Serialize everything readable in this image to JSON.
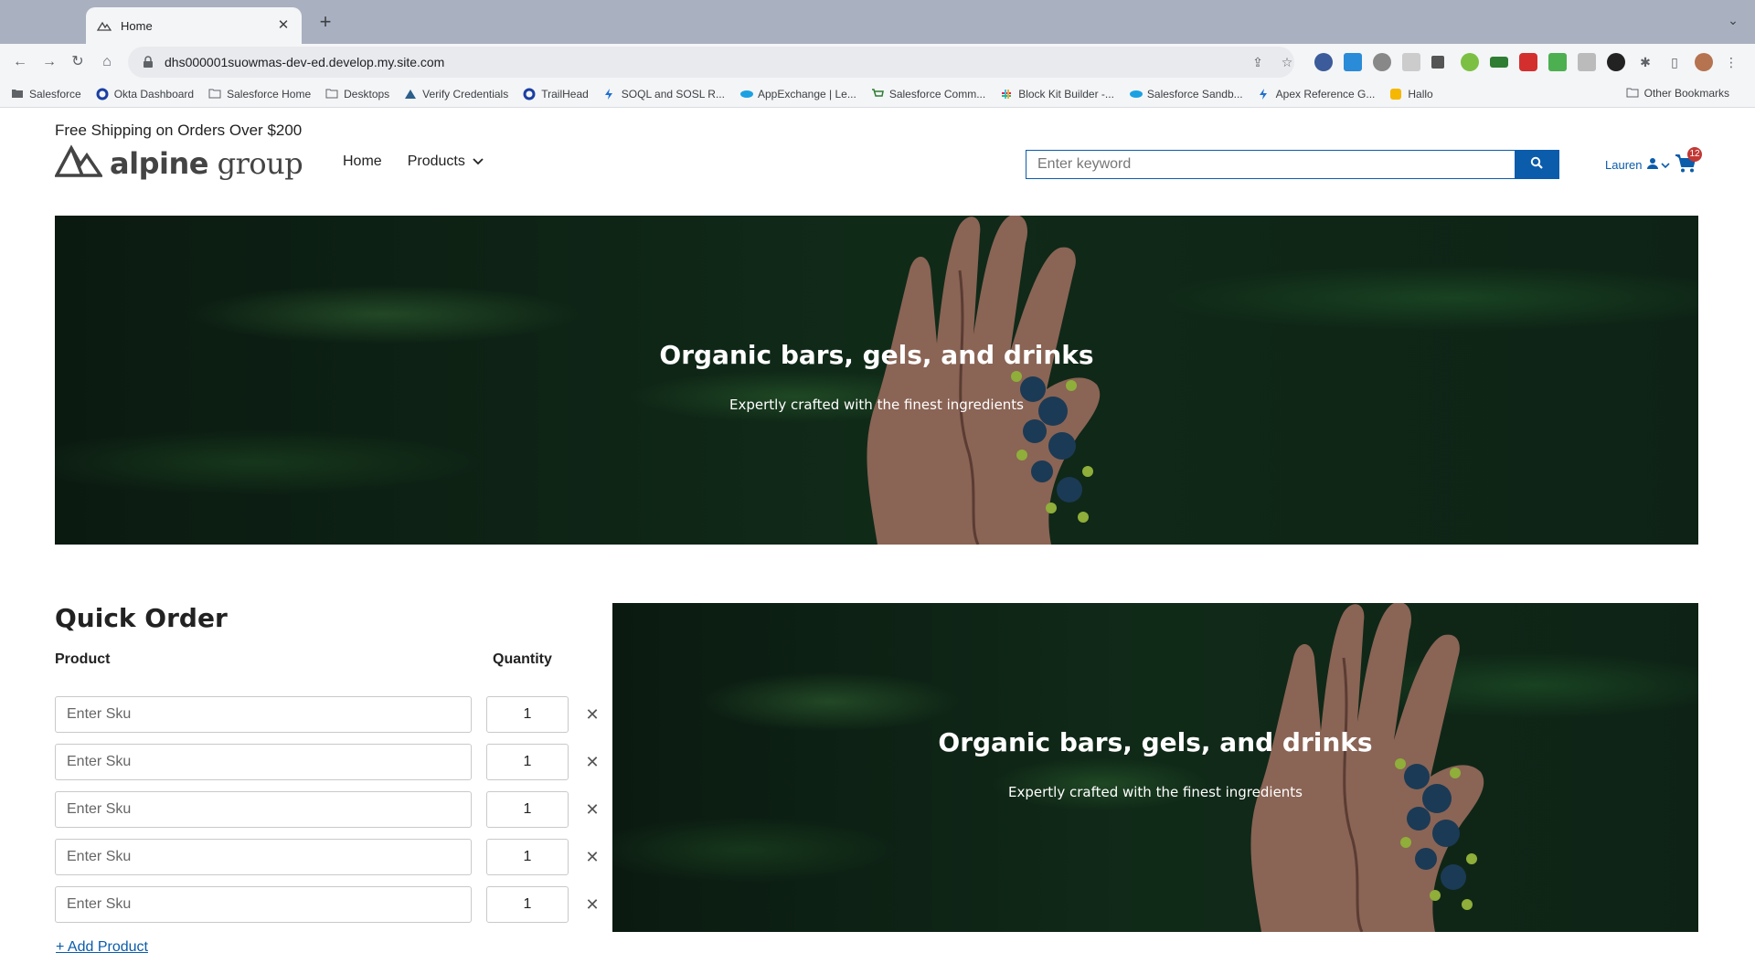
{
  "browser": {
    "tab_title": "Home",
    "url": "dhs000001suowmas-dev-ed.develop.my.site.com",
    "bookmarks": [
      {
        "label": "Salesforce",
        "icon": "folder-icon"
      },
      {
        "label": "Okta Dashboard",
        "icon": "okta-icon"
      },
      {
        "label": "Salesforce Home",
        "icon": "folder-icon"
      },
      {
        "label": "Desktops",
        "icon": "folder-icon"
      },
      {
        "label": "Verify Credentials",
        "icon": "trailhead-icon"
      },
      {
        "label": "TrailHead",
        "icon": "okta-icon"
      },
      {
        "label": "SOQL and SOSL R...",
        "icon": "bolt-icon"
      },
      {
        "label": "AppExchange | Le...",
        "icon": "cloud-icon"
      },
      {
        "label": "Salesforce Comm...",
        "icon": "cart-icon"
      },
      {
        "label": "Block Kit Builder -...",
        "icon": "slack-icon"
      },
      {
        "label": "Salesforce Sandb...",
        "icon": "cloud-icon"
      },
      {
        "label": "Apex Reference G...",
        "icon": "bolt-icon"
      },
      {
        "label": "Hallo",
        "icon": "hallo-icon"
      }
    ],
    "other_bookmarks": "Other Bookmarks"
  },
  "site": {
    "promo": "Free Shipping on Orders Over $200",
    "logo_bold": "alpine",
    "logo_light": "group",
    "nav": {
      "home": "Home",
      "products": "Products"
    },
    "search_placeholder": "Enter keyword",
    "user_name": "Lauren",
    "cart_count": "12"
  },
  "hero": {
    "title": "Organic bars, gels, and drinks",
    "subtitle": "Expertly crafted with the finest ingredients"
  },
  "quick_order": {
    "title": "Quick Order",
    "col_product": "Product",
    "col_quantity": "Quantity",
    "sku_placeholder": "Enter Sku",
    "rows": [
      {
        "quantity": "1"
      },
      {
        "quantity": "1"
      },
      {
        "quantity": "1"
      },
      {
        "quantity": "1"
      },
      {
        "quantity": "1"
      }
    ],
    "add_product": "+ Add Product"
  },
  "colors": {
    "brand_blue": "#0b5cab",
    "badge_red": "#c23934"
  }
}
